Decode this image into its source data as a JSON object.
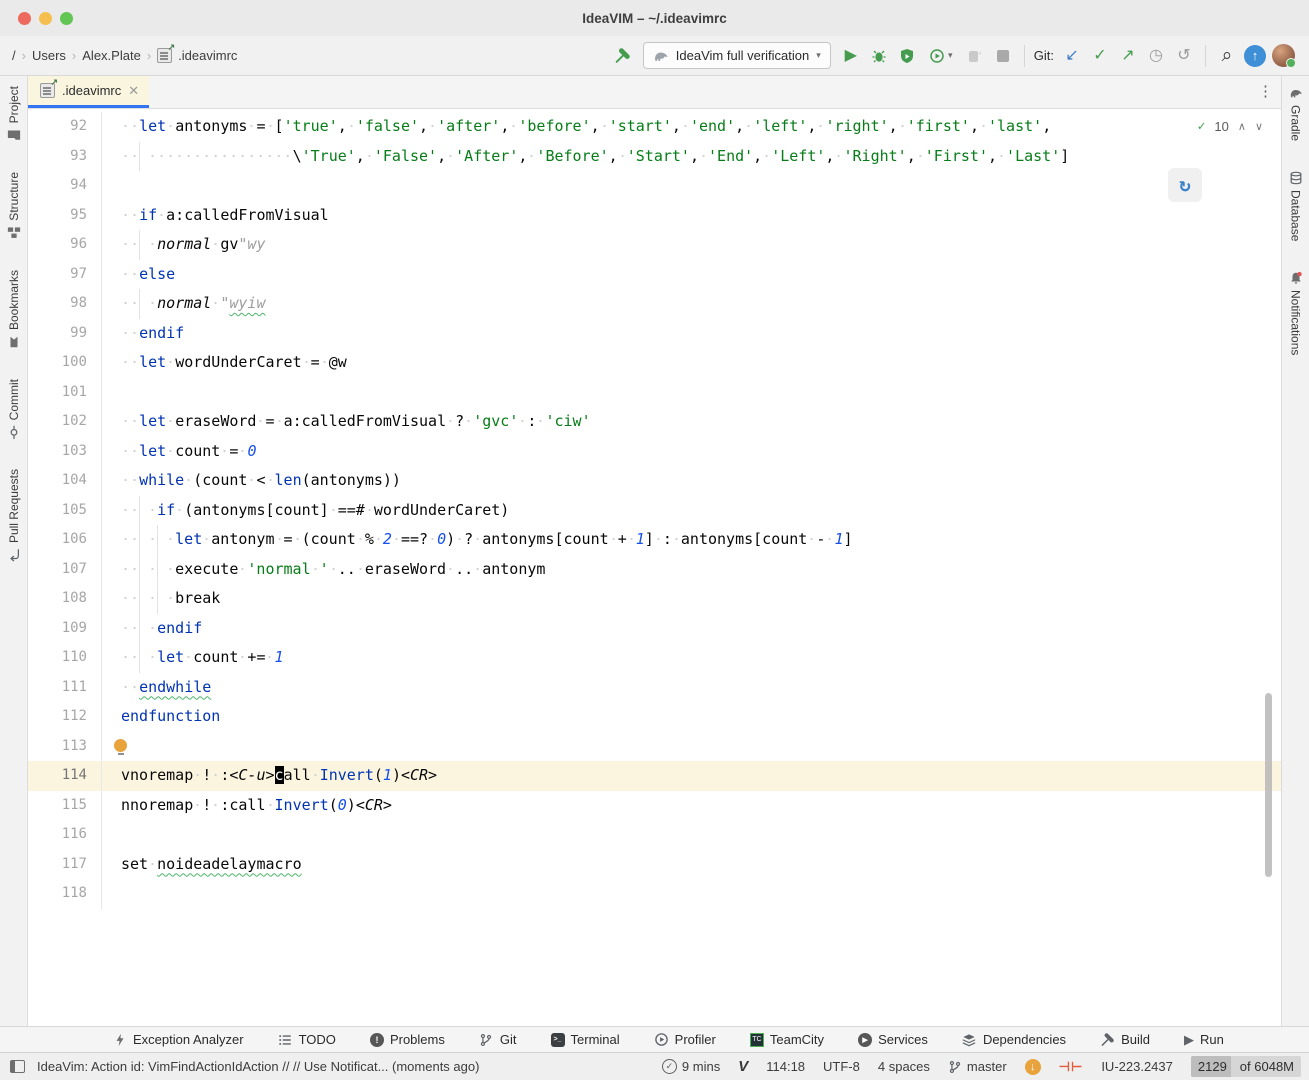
{
  "titlebar": {
    "title": "IdeaVIM – ~/.ideavimrc"
  },
  "toolbar": {
    "breadcrumbs": {
      "root": "/",
      "item1": "Users",
      "item2": "Alex.Plate",
      "item3": ".ideavimrc"
    },
    "run_config": "IdeaVim full verification",
    "git_label": "Git:"
  },
  "tabs": {
    "active": ".ideavimrc"
  },
  "left_stripe": {
    "items": [
      {
        "label": "Project"
      },
      {
        "label": "Structure"
      },
      {
        "label": "Bookmarks"
      },
      {
        "label": "Commit"
      },
      {
        "label": "Pull Requests"
      }
    ]
  },
  "right_stripe": {
    "items": [
      {
        "label": "Gradle"
      },
      {
        "label": "Database"
      },
      {
        "label": "Notifications"
      }
    ]
  },
  "editor": {
    "inspection_count": "10",
    "lines": [
      {
        "n": 92,
        "segs": [
          [
            "t",
            "  "
          ],
          [
            "k",
            "let"
          ],
          [
            "t",
            " antonyms = ["
          ],
          [
            "s",
            "'true'"
          ],
          [
            "t",
            ", "
          ],
          [
            "s",
            "'false'"
          ],
          [
            "t",
            ", "
          ],
          [
            "s",
            "'after'"
          ],
          [
            "t",
            ", "
          ],
          [
            "s",
            "'before'"
          ],
          [
            "t",
            ", "
          ],
          [
            "s",
            "'start'"
          ],
          [
            "t",
            ", "
          ],
          [
            "s",
            "'end'"
          ],
          [
            "t",
            ", "
          ],
          [
            "s",
            "'left'"
          ],
          [
            "t",
            ", "
          ],
          [
            "s",
            "'right'"
          ],
          [
            "t",
            ", "
          ],
          [
            "s",
            "'first'"
          ],
          [
            "t",
            ", "
          ],
          [
            "s",
            "'last'"
          ],
          [
            "t",
            ","
          ]
        ]
      },
      {
        "n": 93,
        "segs": [
          [
            "t",
            "  "
          ],
          [
            "g",
            ""
          ],
          [
            "t",
            "                "
          ],
          [
            "t",
            "\\"
          ],
          [
            "s",
            "'True'"
          ],
          [
            "t",
            ", "
          ],
          [
            "s",
            "'False'"
          ],
          [
            "t",
            ", "
          ],
          [
            "s",
            "'After'"
          ],
          [
            "t",
            ", "
          ],
          [
            "s",
            "'Before'"
          ],
          [
            "t",
            ", "
          ],
          [
            "s",
            "'Start'"
          ],
          [
            "t",
            ", "
          ],
          [
            "s",
            "'End'"
          ],
          [
            "t",
            ", "
          ],
          [
            "s",
            "'Left'"
          ],
          [
            "t",
            ", "
          ],
          [
            "s",
            "'Right'"
          ],
          [
            "t",
            ", "
          ],
          [
            "s",
            "'First'"
          ],
          [
            "t",
            ", "
          ],
          [
            "s",
            "'Last'"
          ],
          [
            "t",
            "]"
          ]
        ]
      },
      {
        "n": 94,
        "segs": []
      },
      {
        "n": 95,
        "segs": [
          [
            "t",
            "  "
          ],
          [
            "k",
            "if"
          ],
          [
            "t",
            " a:calledFromVisual"
          ]
        ]
      },
      {
        "n": 96,
        "segs": [
          [
            "t",
            "  "
          ],
          [
            "g",
            ""
          ],
          [
            "t",
            " "
          ],
          [
            "i",
            "normal"
          ],
          [
            "t",
            " gv"
          ],
          [
            "c",
            "\"wy"
          ]
        ]
      },
      {
        "n": 97,
        "segs": [
          [
            "t",
            "  "
          ],
          [
            "k",
            "else"
          ]
        ]
      },
      {
        "n": 98,
        "segs": [
          [
            "t",
            "  "
          ],
          [
            "g",
            ""
          ],
          [
            "t",
            " "
          ],
          [
            "i",
            "normal"
          ],
          [
            "t",
            " "
          ],
          [
            "c",
            "\""
          ],
          [
            "csq",
            "wyiw"
          ]
        ]
      },
      {
        "n": 99,
        "segs": [
          [
            "t",
            "  "
          ],
          [
            "k",
            "endif"
          ]
        ]
      },
      {
        "n": 100,
        "segs": [
          [
            "t",
            "  "
          ],
          [
            "k",
            "let"
          ],
          [
            "t",
            " wordUnderCaret = @w"
          ]
        ]
      },
      {
        "n": 101,
        "segs": []
      },
      {
        "n": 102,
        "segs": [
          [
            "t",
            "  "
          ],
          [
            "k",
            "let"
          ],
          [
            "t",
            " eraseWord = a:calledFromVisual ? "
          ],
          [
            "s",
            "'gvc'"
          ],
          [
            "t",
            " : "
          ],
          [
            "s",
            "'ciw'"
          ]
        ]
      },
      {
        "n": 103,
        "segs": [
          [
            "t",
            "  "
          ],
          [
            "k",
            "let"
          ],
          [
            "t",
            " count = "
          ],
          [
            "n2",
            "0"
          ]
        ]
      },
      {
        "n": 104,
        "segs": [
          [
            "t",
            "  "
          ],
          [
            "k",
            "while"
          ],
          [
            "t",
            " (count < "
          ],
          [
            "f",
            "len"
          ],
          [
            "t",
            "(antonyms))"
          ]
        ]
      },
      {
        "n": 105,
        "segs": [
          [
            "t",
            "  "
          ],
          [
            "g",
            ""
          ],
          [
            "t",
            " "
          ],
          [
            "k",
            "if"
          ],
          [
            "t",
            " (antonyms[count] ==# wordUnderCaret)"
          ]
        ]
      },
      {
        "n": 106,
        "segs": [
          [
            "t",
            "  "
          ],
          [
            "g",
            ""
          ],
          [
            "t",
            " "
          ],
          [
            "g",
            ""
          ],
          [
            "t",
            " "
          ],
          [
            "k",
            "let"
          ],
          [
            "t",
            " antonym = (count % "
          ],
          [
            "n2",
            "2"
          ],
          [
            "t",
            " ==? "
          ],
          [
            "n2",
            "0"
          ],
          [
            "t",
            ") ? antonyms[count + "
          ],
          [
            "n2",
            "1"
          ],
          [
            "t",
            "] : antonyms[count - "
          ],
          [
            "n2",
            "1"
          ],
          [
            "t",
            "]"
          ]
        ]
      },
      {
        "n": 107,
        "segs": [
          [
            "t",
            "  "
          ],
          [
            "g",
            ""
          ],
          [
            "t",
            " "
          ],
          [
            "g",
            ""
          ],
          [
            "t",
            " "
          ],
          [
            "t",
            "execute "
          ],
          [
            "s",
            "'normal '"
          ],
          [
            "t",
            " .. eraseWord .. antonym"
          ]
        ]
      },
      {
        "n": 108,
        "segs": [
          [
            "t",
            "  "
          ],
          [
            "g",
            ""
          ],
          [
            "t",
            " "
          ],
          [
            "g",
            ""
          ],
          [
            "t",
            " "
          ],
          [
            "t",
            "break"
          ]
        ]
      },
      {
        "n": 109,
        "segs": [
          [
            "t",
            "  "
          ],
          [
            "g",
            ""
          ],
          [
            "t",
            " "
          ],
          [
            "k",
            "endif"
          ]
        ]
      },
      {
        "n": 110,
        "segs": [
          [
            "t",
            "  "
          ],
          [
            "g",
            ""
          ],
          [
            "t",
            " "
          ],
          [
            "k",
            "let"
          ],
          [
            "t",
            " count += "
          ],
          [
            "n2",
            "1"
          ]
        ]
      },
      {
        "n": 111,
        "segs": [
          [
            "t",
            "  "
          ],
          [
            "ksq",
            "endwhile"
          ]
        ]
      },
      {
        "n": 112,
        "segs": [
          [
            "k",
            "endfunction"
          ]
        ]
      },
      {
        "n": 113,
        "bulb": true,
        "segs": []
      },
      {
        "n": 114,
        "active": true,
        "segs": [
          [
            "t",
            "vnoremap ! :"
          ],
          [
            "i",
            "<C-u>"
          ],
          [
            "cur",
            "c"
          ],
          [
            "t",
            "all "
          ],
          [
            "f",
            "Invert"
          ],
          [
            "t",
            "("
          ],
          [
            "n2",
            "1"
          ],
          [
            "t",
            ")"
          ],
          [
            "i",
            "<CR>"
          ]
        ]
      },
      {
        "n": 115,
        "segs": [
          [
            "t",
            "nnoremap ! :call "
          ],
          [
            "f",
            "Invert"
          ],
          [
            "t",
            "("
          ],
          [
            "n2",
            "0"
          ],
          [
            "t",
            ")"
          ],
          [
            "i",
            "<CR>"
          ]
        ]
      },
      {
        "n": 116,
        "segs": []
      },
      {
        "n": 117,
        "segs": [
          [
            "t",
            "set "
          ],
          [
            "tsq",
            "noideadelaymacro"
          ]
        ]
      },
      {
        "n": 118,
        "segs": []
      }
    ]
  },
  "bottom_toolbar": {
    "items": [
      {
        "label": "Exception Analyzer"
      },
      {
        "label": "TODO"
      },
      {
        "label": "Problems"
      },
      {
        "label": "Git"
      },
      {
        "label": "Terminal"
      },
      {
        "label": "Profiler"
      },
      {
        "label": "TeamCity"
      },
      {
        "label": "Services"
      },
      {
        "label": "Dependencies"
      },
      {
        "label": "Build"
      },
      {
        "label": "Run"
      }
    ]
  },
  "bottom_icons": {
    "terminal_glyph": ">_",
    "teamcity_glyph": "TC",
    "problems_glyph": "!",
    "run_glyph": "▶",
    "services_glyph": "▶"
  },
  "statusbar": {
    "message": "IdeaVim: Action id: VimFindActionIdAction // // Use Notificat... (moments ago)",
    "time": "9 mins",
    "vim_glyph": "V",
    "position": "114:18",
    "encoding": "UTF-8",
    "indent": "4 spaces",
    "branch": "master",
    "red_indicator": "⊣⊢",
    "build": "IU-223.2437",
    "memory_used": "2129",
    "memory_total": "of 6048M"
  },
  "glyphs": {
    "run": "▶",
    "commit_check": "✓",
    "git_update": "↙",
    "git_push": "↗",
    "history_clock": "◷",
    "rollback": "↺",
    "refresh": "↻",
    "search": "⌕",
    "update_arrow": "↑",
    "down_arrow": "↓",
    "chevron_up": "∧",
    "chevron_down": "∨",
    "tab_close": "✕",
    "tab_more": "⋮",
    "inspection_ok": "✓",
    "crumb_sep": "›",
    "dropdown_caret": "▾"
  },
  "colors": {
    "accent_blue": "#3574F0",
    "caret_row": "#FBF5E0",
    "keyword": "#0033B3",
    "string": "#067D17",
    "number": "#1750EB",
    "comment": "#9E9E9E",
    "squiggle_green": "#4DB56A",
    "action_green": "#459C4F",
    "git_blue": "#3D7EC2",
    "update_blue": "#3E8FD6",
    "bulb_yellow": "#E8A33D",
    "tab_bg": "#FAF5DF"
  }
}
